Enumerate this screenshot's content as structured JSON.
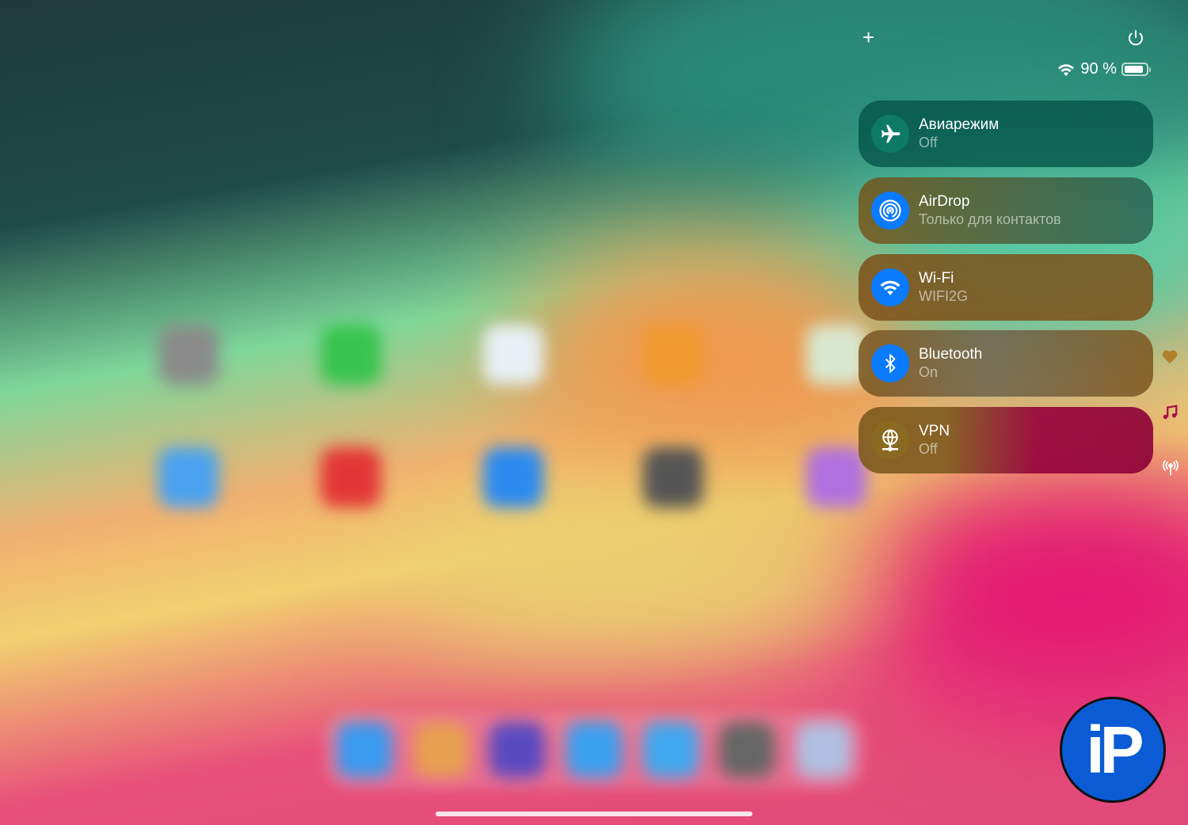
{
  "controls": {
    "add_label": "+",
    "power_icon": "power-icon"
  },
  "status": {
    "battery": "90 %",
    "battery_level": 0.9
  },
  "tiles": [
    {
      "title": "Авиарежим",
      "subtitle": "Off",
      "icon": "airplane-icon",
      "color": "#0d7a66"
    },
    {
      "title": "AirDrop",
      "subtitle": "Только для контактов",
      "icon": "airdrop-icon",
      "color": "#0a7aff"
    },
    {
      "title": "Wi-Fi",
      "subtitle": "WIFI2G",
      "icon": "wifi-icon",
      "color": "#0a7aff"
    },
    {
      "title": "Bluetooth",
      "subtitle": "On",
      "icon": "bluetooth-icon",
      "color": "#0a7aff"
    },
    {
      "title": "VPN",
      "subtitle": "Off",
      "icon": "vpn-icon",
      "color": "#8a6a20"
    }
  ],
  "logo": {
    "text": "iP"
  }
}
